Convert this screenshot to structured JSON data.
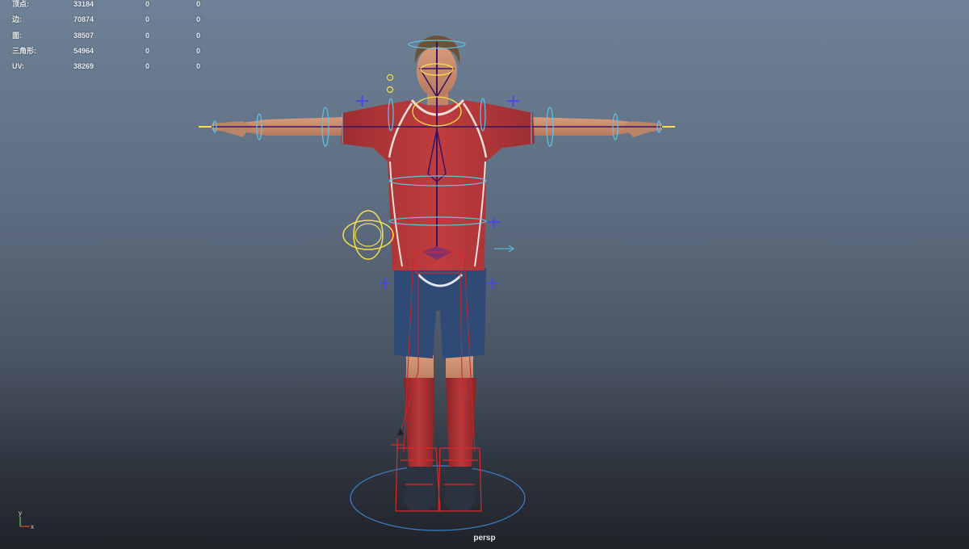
{
  "heads_up_display": {
    "rows": [
      {
        "label": "顶点:",
        "value": "33184",
        "a": "0",
        "b": "0"
      },
      {
        "label": "边:",
        "value": "70874",
        "a": "0",
        "b": "0"
      },
      {
        "label": "面:",
        "value": "38507",
        "a": "0",
        "b": "0"
      },
      {
        "label": "三角形:",
        "value": "54964",
        "a": "0",
        "b": "0"
      },
      {
        "label": "UV:",
        "value": "38269",
        "a": "0",
        "b": "0"
      }
    ]
  },
  "viewport": {
    "camera_label": "persp",
    "axis_labels": {
      "y": "y",
      "x": "x"
    }
  },
  "colors": {
    "background_top": "#6f8196",
    "background_bottom": "#202228",
    "shirt": "#b3383a",
    "shorts": "#2e4a75",
    "skin": "#c98a6c",
    "control_cyan": "#5fc4e8",
    "control_yellow": "#f4e04d",
    "control_red": "#e0262a",
    "control_blue": "#4a4ae0",
    "joint_dark": "#3b1260"
  }
}
